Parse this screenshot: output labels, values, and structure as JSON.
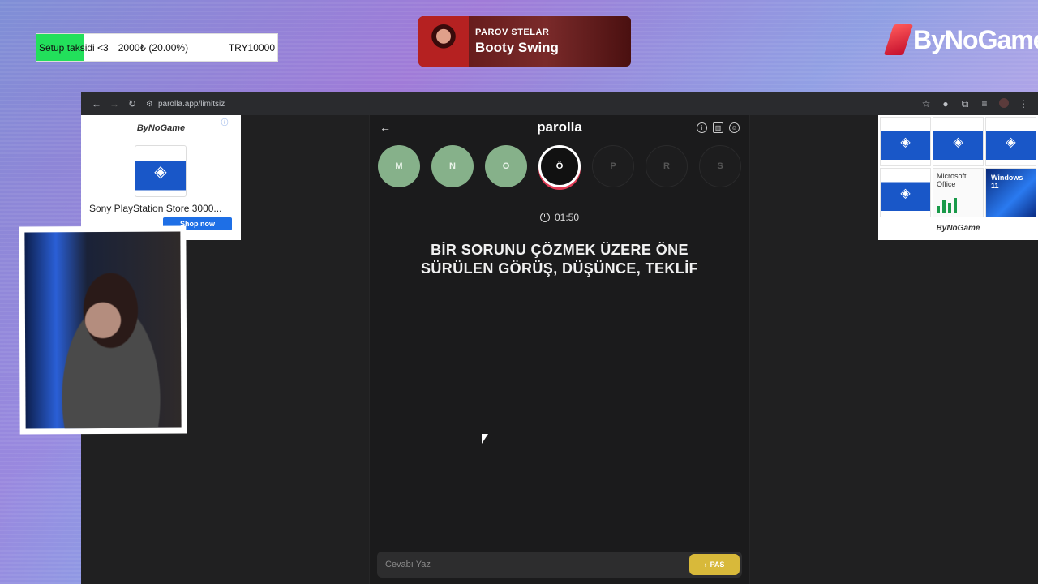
{
  "stream": {
    "goal": {
      "name": "Setup taksidi <3",
      "amount": "2000₺ (20.00%)",
      "target": "TRY10000",
      "progress_percent": 20
    },
    "now_playing": {
      "artist": "PAROV STELAR",
      "title": "Booty Swing"
    },
    "brand": "ByNoGame"
  },
  "browser": {
    "url": "parolla.app/limitsiz",
    "nav": {
      "back_icon": "back-arrow-icon",
      "forward_icon": "forward-arrow-icon",
      "reload_icon": "reload-icon"
    }
  },
  "ads": {
    "left": {
      "logo": "ByNoGame",
      "title": "Sony PlayStation Store 3000...",
      "cta": "Shop now"
    },
    "right": {
      "logo": "ByNoGame",
      "tiles": [
        "PS Store",
        "PS Store",
        "PS Store",
        "PS Store",
        "Microsoft Office",
        "Windows 11"
      ],
      "office_label": "Microsoft Office",
      "windows_label": "Windows 11"
    }
  },
  "game": {
    "title": "parolla",
    "letters": [
      {
        "char": "M",
        "state": "done"
      },
      {
        "char": "N",
        "state": "done"
      },
      {
        "char": "O",
        "state": "done"
      },
      {
        "char": "Ö",
        "state": "active"
      },
      {
        "char": "P",
        "state": "pending"
      },
      {
        "char": "R",
        "state": "pending"
      },
      {
        "char": "S",
        "state": "pending"
      }
    ],
    "timer": "01:50",
    "question_line1": "BİR SORUNU ÇÖZMEK ÜZERE ÖNE",
    "question_line2": "SÜRÜLEN GÖRÜŞ, DÜŞÜNCE, TEKLİF",
    "answer_placeholder": "Cevabı Yaz",
    "pass_label": "PAS"
  },
  "colors": {
    "done": "#86b18a",
    "active_ring": "#e23b55",
    "pass_button": "#d8b93a",
    "goal_fill": "#22e05b"
  }
}
